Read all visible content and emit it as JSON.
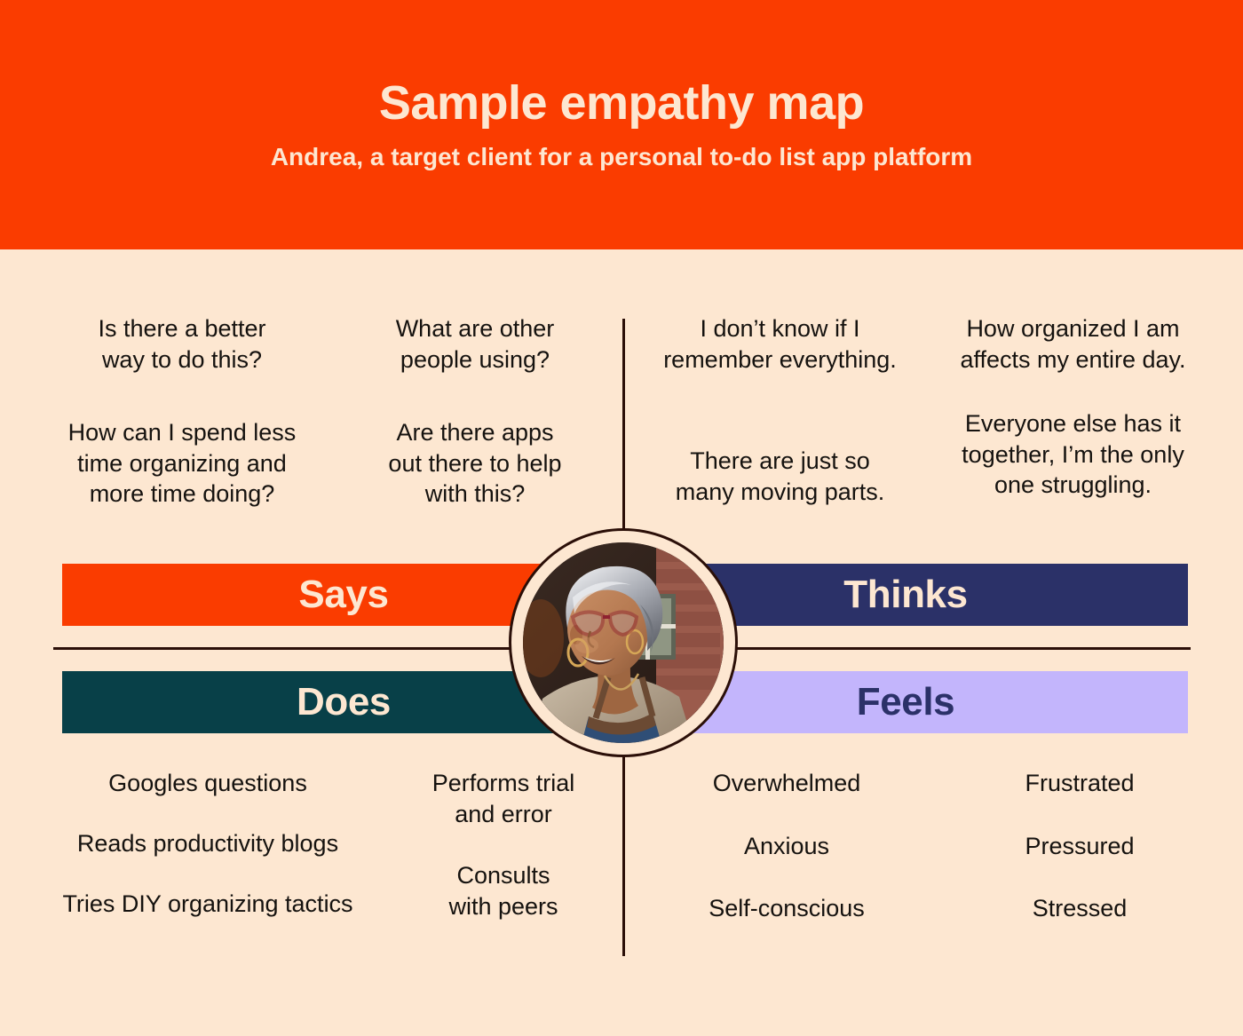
{
  "header": {
    "title": "Sample empathy map",
    "subtitle": "Andrea, a target client for a personal to-do list app platform",
    "bg_color": "#FA3C00",
    "text_color": "#FDE7D1"
  },
  "page": {
    "background_color": "#FDE7D1",
    "text_color": "#15120F",
    "divider_color": "#2B0F08"
  },
  "portrait": {
    "alt": "Andrea, smiling woman with grey hair, red glasses and hoop earrings, wearing an apron",
    "ring_color": "#2B0F08"
  },
  "quadrants": {
    "says": {
      "label": "Says",
      "bar_color": "#FA3C00",
      "label_color": "#FDE7D1",
      "column_left": [
        "Is there a better\nway to do this?",
        "How can I spend less\ntime organizing and\nmore time doing?"
      ],
      "column_right": [
        "What are other\npeople using?",
        "Are there apps\nout there to help\nwith this?"
      ]
    },
    "thinks": {
      "label": "Thinks",
      "bar_color": "#2B3168",
      "label_color": "#FDE7D1",
      "column_left": [
        "I don’t know if I\nremember everything.",
        "There are just so\nmany moving parts."
      ],
      "column_right": [
        "How organized I am\naffects my entire day.",
        "Everyone else has it\ntogether, I’m the only\none struggling."
      ]
    },
    "does": {
      "label": "Does",
      "bar_color": "#084048",
      "label_color": "#FDE7D1",
      "column_left": [
        "Googles questions",
        "Reads productivity blogs",
        "Tries DIY organizing tactics"
      ],
      "column_right": [
        "Performs trial\nand error",
        "Consults\nwith peers"
      ]
    },
    "feels": {
      "label": "Feels",
      "bar_color": "#C3B5FC",
      "label_color": "#2B3168",
      "column_left": [
        "Overwhelmed",
        "Anxious",
        "Self-conscious"
      ],
      "column_right": [
        "Frustrated",
        "Pressured",
        "Stressed"
      ]
    }
  }
}
